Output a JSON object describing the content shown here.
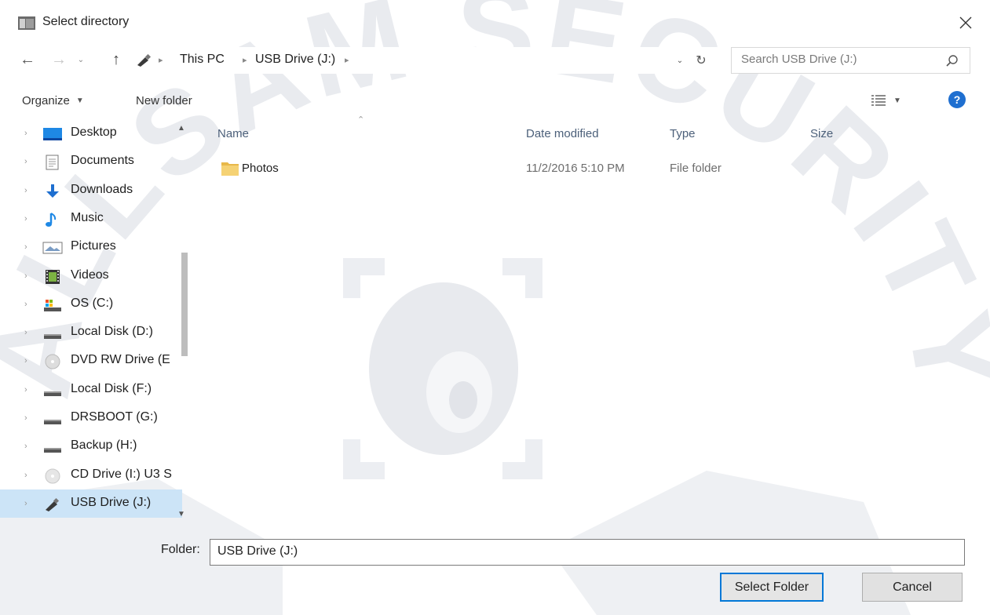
{
  "dialog": {
    "title": "Select directory",
    "close_icon": "close-icon"
  },
  "navigation": {
    "breadcrumb": [
      "This PC",
      "USB Drive (J:)"
    ],
    "search_placeholder": "Search USB Drive (J:)"
  },
  "toolbar": {
    "organize_label": "Organize",
    "new_folder_label": "New folder"
  },
  "sidebar": {
    "items": [
      {
        "label": "Desktop",
        "icon": "desktop-icon"
      },
      {
        "label": "Documents",
        "icon": "documents-icon"
      },
      {
        "label": "Downloads",
        "icon": "downloads-icon"
      },
      {
        "label": "Music",
        "icon": "music-icon"
      },
      {
        "label": "Pictures",
        "icon": "pictures-icon"
      },
      {
        "label": "Videos",
        "icon": "videos-icon"
      },
      {
        "label": "OS (C:)",
        "icon": "os-drive-icon"
      },
      {
        "label": "Local Disk (D:)",
        "icon": "disk-drive-icon"
      },
      {
        "label": "DVD RW Drive (E",
        "icon": "dvd-drive-icon"
      },
      {
        "label": "Local Disk (F:)",
        "icon": "disk-drive-icon"
      },
      {
        "label": "DRSBOOT (G:)",
        "icon": "disk-drive-icon"
      },
      {
        "label": "Backup (H:)",
        "icon": "disk-drive-icon"
      },
      {
        "label": "CD Drive (I:) U3 S",
        "icon": "cd-drive-icon"
      },
      {
        "label": "USB Drive (J:)",
        "icon": "usb-drive-icon",
        "selected": true
      }
    ]
  },
  "file_list": {
    "columns": [
      "Name",
      "Date modified",
      "Type",
      "Size"
    ],
    "rows": [
      {
        "name": "Photos",
        "date_modified": "11/2/2016 5:10 PM",
        "type": "File folder",
        "size": ""
      }
    ]
  },
  "footer": {
    "folder_label": "Folder:",
    "folder_value": "USB Drive (J:)",
    "select_button": "Select Folder",
    "cancel_button": "Cancel"
  },
  "watermark": {
    "text": "ALLSAM SECURITY"
  },
  "colors": {
    "selection": "#cce4f7",
    "accent": "#0078d7",
    "folder": "#f5d274",
    "help": "#1f6fd0"
  }
}
